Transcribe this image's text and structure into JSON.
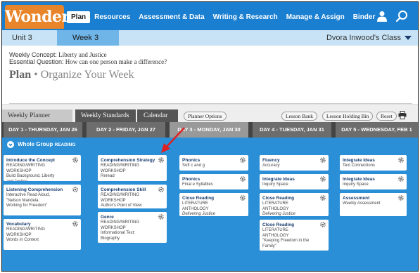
{
  "header": {
    "logo": "Wonders",
    "nav": [
      "Plan",
      "Resources",
      "Assessment & Data",
      "Writing & Research",
      "Manage & Assign",
      "Binder"
    ],
    "active_nav": "Plan"
  },
  "week_bar": {
    "unit": "Unit 3",
    "week": "Week 3",
    "class_name": "Dvora Inwood's Class"
  },
  "concept": {
    "weekly_label": "Weekly Concept:",
    "weekly_value": "Liberty and Justice",
    "question_label": "Essential Question:",
    "question_value": "How can one person make a difference?",
    "plan_word": "Plan",
    "plan_sep": " • ",
    "plan_subtitle": "Organize Your Week"
  },
  "tabs": {
    "weekly_planner": "Weekly Planner",
    "weekly_standards": "Weekly Standards",
    "calendar": "Calendar",
    "planner_options": "Planner Options",
    "lesson_bank": "Lesson Bank",
    "lesson_holding_bin": "Lesson Holding Bin",
    "reset": "Reset"
  },
  "days": [
    "DAY 1 - THURSDAY, JAN 26",
    "DAY 2 - FRIDAY, JAN 27",
    "DAY 3 - MONDAY, JAN 30",
    "DAY 4 - TUESDAY, JAN 31",
    "DAY 5 - WEDNESDAY, FEB 1"
  ],
  "whole_group": {
    "label": "Whole Group",
    "sub": "READING"
  },
  "columns": [
    {
      "cards": [
        {
          "title": "Introduce the Concept",
          "sub": [
            "READING/WRITING",
            "WORKSHOP",
            "Build Background, Liberty",
            "and Justice"
          ],
          "italic": []
        },
        {
          "title": "Listening Comprehension",
          "sub": [
            "Interactive Read Aloud,",
            "\"Nelson Mandela:",
            "Working for Freedom\""
          ],
          "italic": []
        },
        {
          "title": "Vocabulary",
          "sub": [
            "READING/WRITING",
            "WORKSHOP",
            "Words in Context"
          ],
          "italic": []
        }
      ]
    },
    {
      "cards": [
        {
          "title": "Comprehension Strategy",
          "sub": [
            "READING/WRITING",
            "WORKSHOP",
            "Reread"
          ],
          "italic": []
        },
        {
          "title": "Comprehension Skill",
          "sub": [
            "READING/WRITING",
            "WORKSHOP",
            "Author's Point of View"
          ],
          "italic": []
        },
        {
          "title": "Genre",
          "sub": [
            "READING/WRITING",
            "WORKSHOP",
            "Informational Text:",
            "Biography"
          ],
          "italic": []
        }
      ]
    },
    {
      "cards": [
        {
          "title": "Phonics",
          "sub": [
            "Soft c and g"
          ],
          "italic": []
        },
        {
          "title": "Phonics",
          "sub": [
            "Final e Syllables"
          ],
          "italic": []
        },
        {
          "title": "Close Reading",
          "sub": [
            "LITERATURE",
            "ANTHOLOGY"
          ],
          "italic": [
            "Delivering Justice"
          ]
        }
      ]
    },
    {
      "cards": [
        {
          "title": "Fluency",
          "sub": [
            "Accuracy"
          ],
          "italic": []
        },
        {
          "title": "Integrate Ideas",
          "sub": [
            "Inquiry Space"
          ],
          "italic": []
        },
        {
          "title": "Close Reading",
          "sub": [
            "LITERATURE",
            "ANTHOLOGY"
          ],
          "italic": [
            "Delivering Justice"
          ]
        },
        {
          "title": "Close Reading",
          "sub": [
            "LITERATURE",
            "ANTHOLOGY",
            "\"Keeping Freedom in the",
            "Family\""
          ],
          "italic": []
        }
      ]
    },
    {
      "cards": [
        {
          "title": "Integrate Ideas",
          "sub": [
            "Text Connections"
          ],
          "italic": []
        },
        {
          "title": "Integrate Ideas",
          "sub": [
            "Inquiry Space"
          ],
          "italic": []
        },
        {
          "title": "Assessment",
          "sub": [
            "Weekly Assessment"
          ],
          "italic": []
        }
      ]
    }
  ]
}
